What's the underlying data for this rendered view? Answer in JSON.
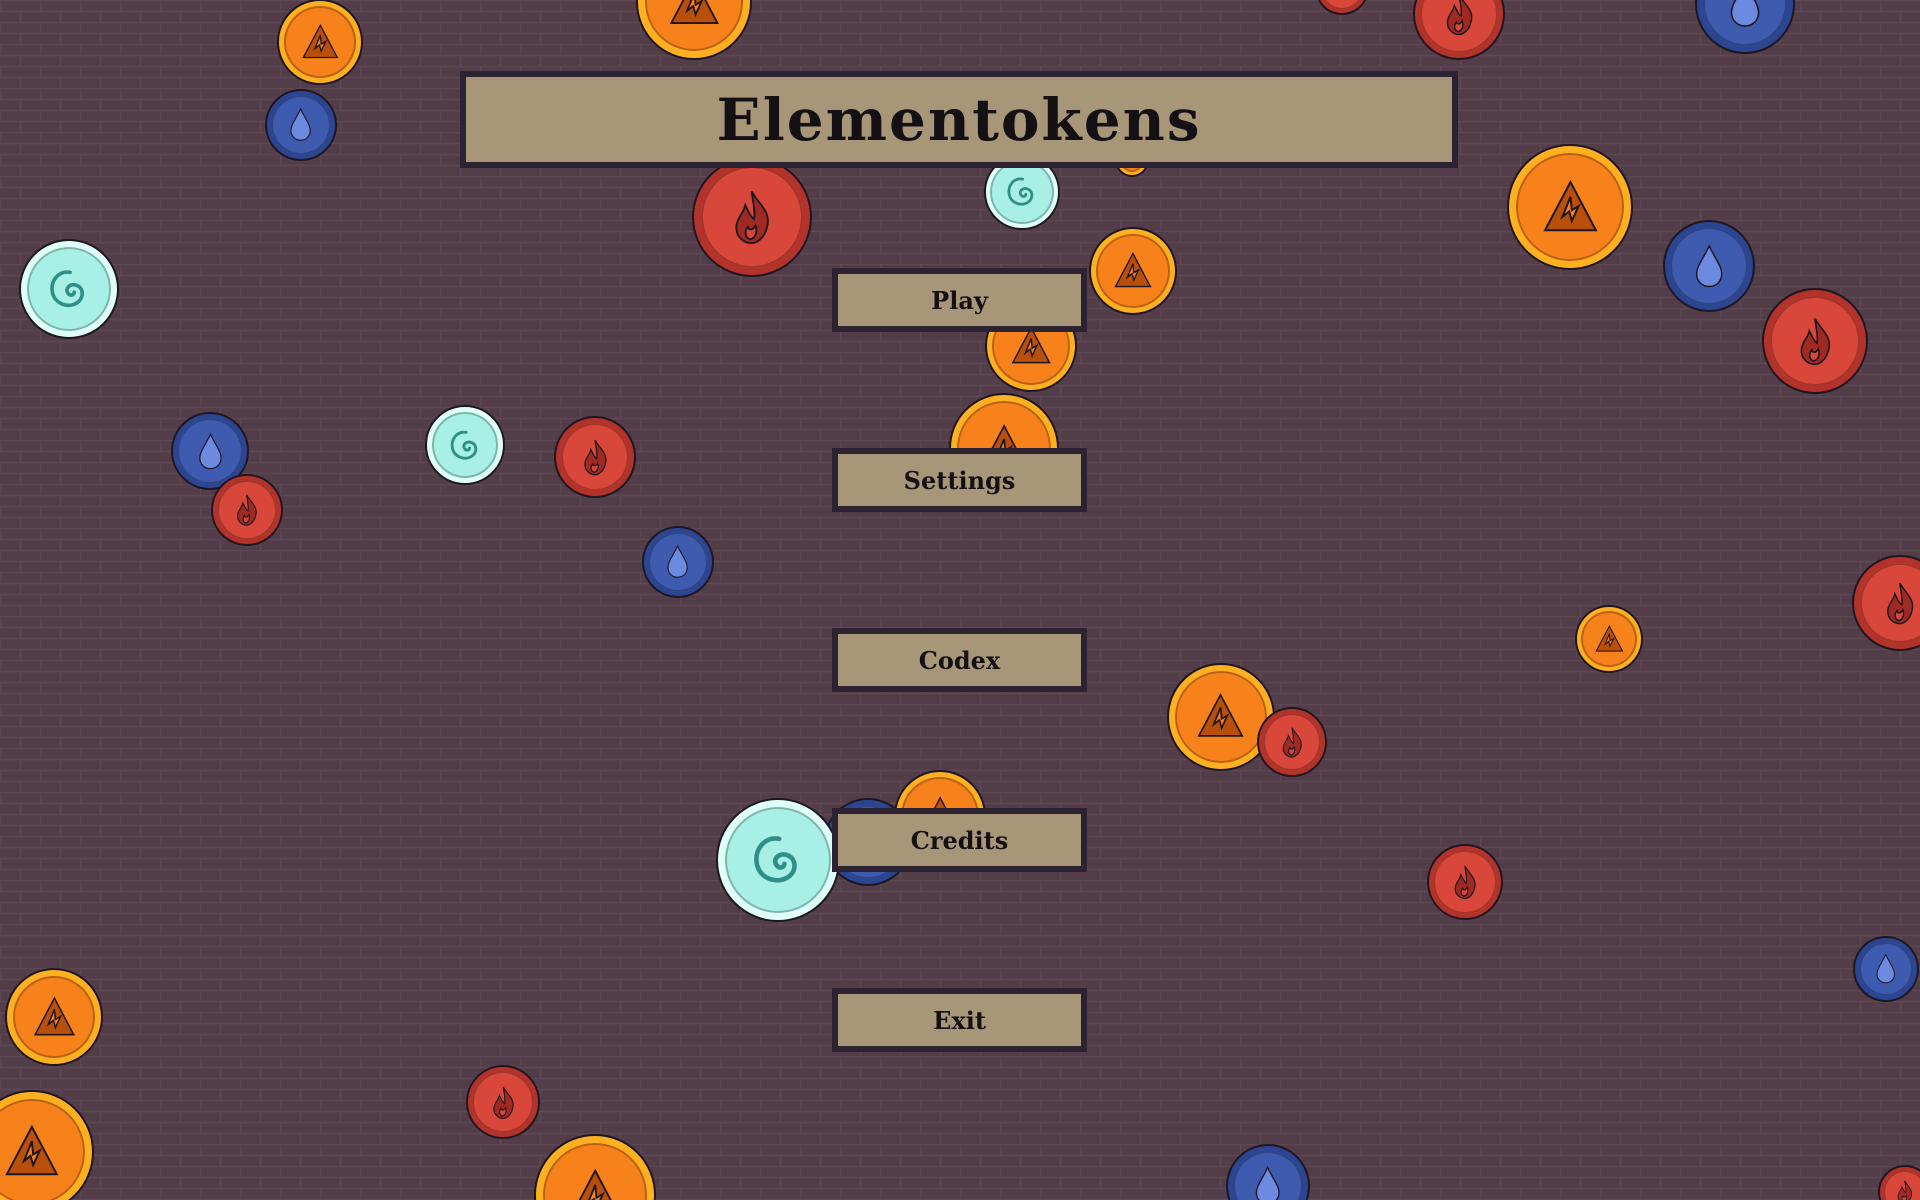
{
  "title": "Elementokens",
  "menu": {
    "play": "Play",
    "settings": "Settings",
    "codex": "Codex",
    "credits": "Credits",
    "exit": "Exit"
  },
  "palette": {
    "background": "#523d49",
    "brick_line": "#5a4450",
    "button_fill": "#a89679",
    "button_border": "#2d2232",
    "fire": "#d9473a",
    "earth": "#f7821b",
    "water": "#3e5bb0",
    "air": "#a8f0e6"
  },
  "token_kinds": {
    "fire": {
      "icon": "flame-icon",
      "fill": "#d9473a",
      "ring": "#b3332a",
      "glyph": "#a02a22"
    },
    "earth": {
      "icon": "mountain-icon",
      "fill": "#f7821b",
      "ring": "#ffb020",
      "glyph": "#b84f0a"
    },
    "water": {
      "icon": "droplet-icon",
      "fill": "#3e5bb0",
      "ring": "#2b4592",
      "glyph": "#6b8ae0"
    },
    "air": {
      "icon": "swirl-icon",
      "fill": "#a8f0e6",
      "ring": "#dffff9",
      "glyph": "#2f8f86"
    }
  }
}
